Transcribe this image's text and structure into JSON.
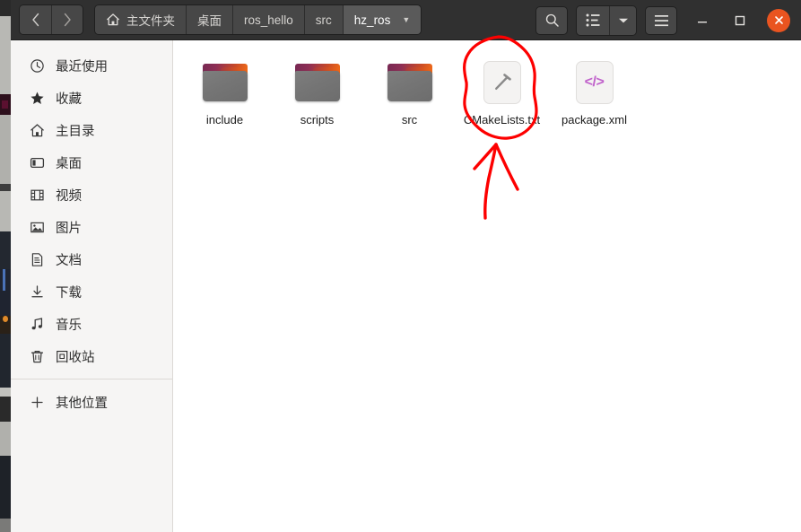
{
  "window": {
    "app": "files-manager",
    "theme_accent": "#e95420",
    "headerbar_bg": "#303030"
  },
  "nav": {
    "back_label": "‹",
    "back_name": "back-icon",
    "forward_label": "›",
    "forward_name": "forward-icon"
  },
  "breadcrumb": {
    "items": [
      {
        "label": "主文件夹",
        "icon": "home-icon",
        "active": false
      },
      {
        "label": "桌面",
        "icon": "",
        "active": false
      },
      {
        "label": "ros_hello",
        "icon": "",
        "active": false
      },
      {
        "label": "src",
        "icon": "",
        "active": false
      },
      {
        "label": "hz_ros",
        "icon": "chevron-down-icon",
        "active": true
      }
    ]
  },
  "toolbar": {
    "search_label": "search-icon",
    "view_list_label": "list-view-icon",
    "view_menu_label": "chevron-down-icon",
    "menu_label": "hamburger-menu-icon"
  },
  "window_controls": {
    "minimize": "—",
    "maximize": "□",
    "close": "✕"
  },
  "sidebar": {
    "items": [
      {
        "label": "最近使用",
        "icon": "clock-icon"
      },
      {
        "label": "收藏",
        "icon": "star-icon"
      },
      {
        "label": "主目录",
        "icon": "home-icon"
      },
      {
        "label": "桌面",
        "icon": "desktop-icon"
      },
      {
        "label": "视频",
        "icon": "film-icon"
      },
      {
        "label": "图片",
        "icon": "image-icon"
      },
      {
        "label": "文档",
        "icon": "document-icon"
      },
      {
        "label": "下载",
        "icon": "download-icon"
      },
      {
        "label": "音乐",
        "icon": "music-note-icon"
      },
      {
        "label": "回收站",
        "icon": "trash-icon"
      }
    ],
    "other_locations": {
      "label": "其他位置",
      "icon": "plus-icon"
    }
  },
  "files": [
    {
      "name": "include",
      "type": "folder"
    },
    {
      "name": "scripts",
      "type": "folder"
    },
    {
      "name": "src",
      "type": "folder"
    },
    {
      "name": "CMakeLists.txt",
      "type": "build-file",
      "glyph": "hammer-icon",
      "annotated": true
    },
    {
      "name": "package.xml",
      "type": "code-file",
      "glyph": "</>"
    }
  ],
  "annotation": {
    "color": "#fd0000",
    "shapes": [
      "circle-around-CMakeLists.txt",
      "upward-arrow"
    ]
  }
}
